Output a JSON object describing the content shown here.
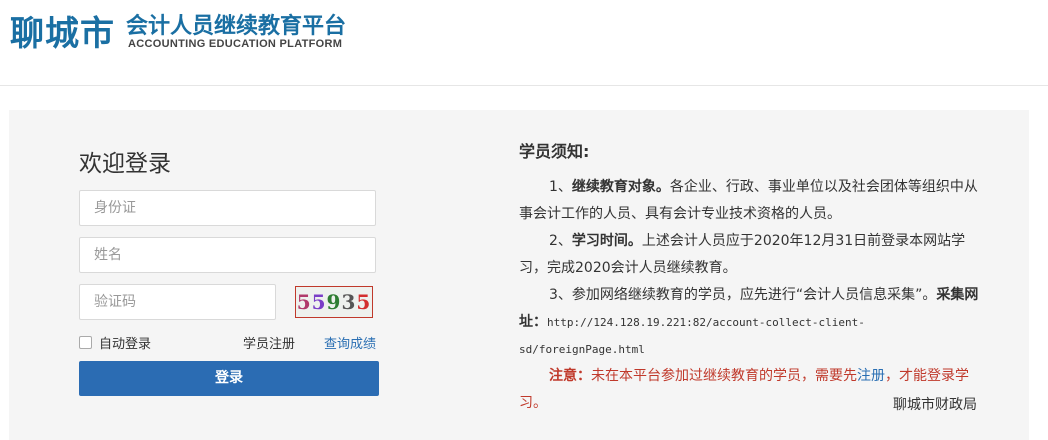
{
  "header": {
    "city": "聊城市",
    "title": "会计人员继续教育平台",
    "subtitle": "ACCOUNTING EDUCATION PLATFORM"
  },
  "login": {
    "welcome": "欢迎登录",
    "id_placeholder": "身份证",
    "name_placeholder": "姓名",
    "captcha_placeholder": "验证码",
    "captcha_chars": [
      "5",
      "5",
      "9",
      "3",
      "5"
    ],
    "remember_label": "自动登录",
    "register_label": "学员注册",
    "query_label": "查询成绩",
    "submit_label": "登录"
  },
  "notice": {
    "title": "学员须知:",
    "item1_lead": "1、",
    "item1_bold": "继续教育对象。",
    "item1_text": "各企业、行政、事业单位以及社会团体等组织中从事会计工作的人员、具有会计专业技术资格的人员。",
    "item2_lead": "2、",
    "item2_bold": "学习时间。",
    "item2_text": "上述会计人员应于2020年12月31日前登录本网站学习，完成2020会计人员继续教育。",
    "item3_text": "3、参加网络继续教育的学员，应先进行“会计人员信息采集”。",
    "item3_bold": "采集网址：",
    "item3_url": "http://124.128.19.221:82/account-collect-client-sd/foreignPage.html",
    "warn_bold": "注意：",
    "warn_text1": "未在本平台参加过继续教育的学员，需要先",
    "warn_link": "注册",
    "warn_text2": "，才能登录学习。",
    "signature": "聊城市财政局"
  }
}
